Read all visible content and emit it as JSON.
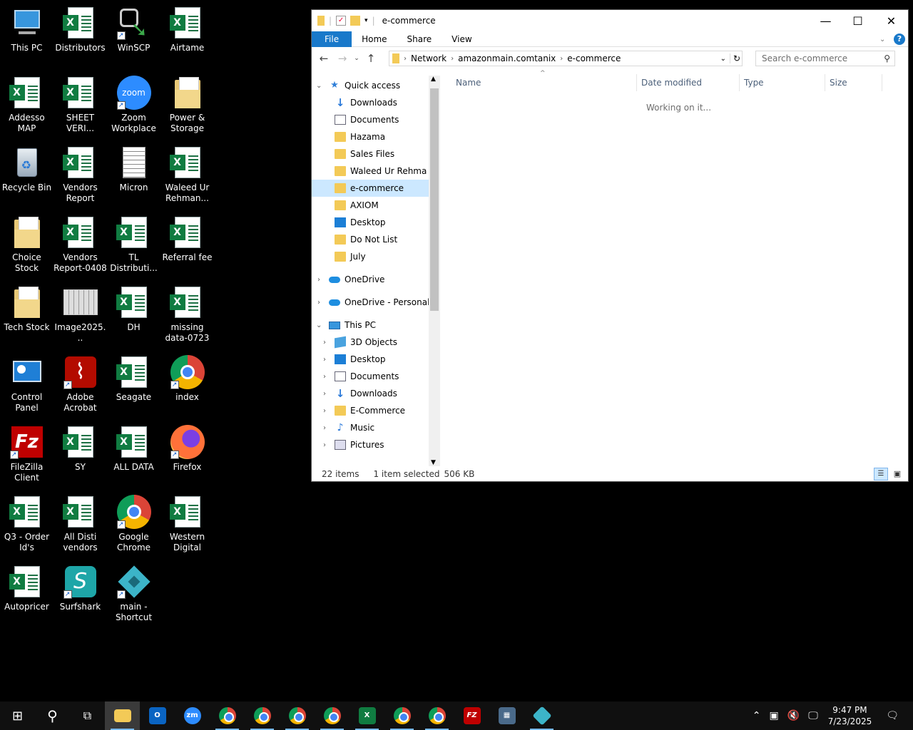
{
  "desktop": {
    "icons": [
      {
        "label": "This PC",
        "icon": "this-pc-icon"
      },
      {
        "label": "Distributors",
        "icon": "excel-icon"
      },
      {
        "label": "WinSCP",
        "icon": "winscp-icon"
      },
      {
        "label": "Airtame",
        "icon": "excel-icon"
      },
      {
        "label": "Addesso MAP",
        "icon": "excel-icon"
      },
      {
        "label": "SHEET VERI...",
        "icon": "excel-icon"
      },
      {
        "label": "Zoom Workplace",
        "icon": "zoom-icon"
      },
      {
        "label": "Power & Storage",
        "icon": "folder-icon"
      },
      {
        "label": "Recycle Bin",
        "icon": "recycle-bin-icon"
      },
      {
        "label": "Vendors Report",
        "icon": "excel-icon"
      },
      {
        "label": "Micron",
        "icon": "text-document-icon"
      },
      {
        "label": "Waleed Ur Rehman...",
        "icon": "excel-icon"
      },
      {
        "label": "Choice Stock",
        "icon": "folder-icon"
      },
      {
        "label": "Vendors Report-0408",
        "icon": "excel-icon"
      },
      {
        "label": "TL Distributi...",
        "icon": "excel-icon"
      },
      {
        "label": "Referral fee",
        "icon": "excel-icon"
      },
      {
        "label": "Tech Stock",
        "icon": "folder-icon"
      },
      {
        "label": "Image2025...",
        "icon": "image-icon"
      },
      {
        "label": "DH",
        "icon": "excel-icon"
      },
      {
        "label": "missing data-0723",
        "icon": "excel-icon"
      },
      {
        "label": "Control Panel",
        "icon": "control-panel-icon"
      },
      {
        "label": "Adobe Acrobat",
        "icon": "acrobat-icon"
      },
      {
        "label": "Seagate",
        "icon": "excel-icon"
      },
      {
        "label": "index",
        "icon": "chrome-icon"
      },
      {
        "label": "FileZilla Client",
        "icon": "filezilla-icon"
      },
      {
        "label": "SY",
        "icon": "excel-icon"
      },
      {
        "label": "ALL DATA",
        "icon": "excel-icon"
      },
      {
        "label": "Firefox",
        "icon": "firefox-icon"
      },
      {
        "label": "Q3 - Order Id's",
        "icon": "excel-icon"
      },
      {
        "label": "All Disti vendors",
        "icon": "excel-icon"
      },
      {
        "label": "Google Chrome",
        "icon": "chrome-icon"
      },
      {
        "label": "Western Digital",
        "icon": "excel-icon"
      },
      {
        "label": "Autopricer",
        "icon": "excel-icon"
      },
      {
        "label": "Surfshark",
        "icon": "surfshark-icon"
      },
      {
        "label": "main - Shortcut",
        "icon": "nutanix-icon"
      }
    ]
  },
  "explorer": {
    "title": "e-commerce",
    "ribbon_tabs": [
      "File",
      "Home",
      "Share",
      "View"
    ],
    "breadcrumb": [
      "Network",
      "amazonmain.comtanix",
      "e-commerce"
    ],
    "search_placeholder": "Search e-commerce",
    "nav": {
      "quick_access": "Quick access",
      "pinned": [
        "Downloads",
        "Documents",
        "Hazama",
        "Sales Files",
        "Waleed Ur Rehma",
        "e-commerce"
      ],
      "recent": [
        "AXIOM",
        "Desktop",
        "Do Not List",
        "July"
      ],
      "onedrive": "OneDrive",
      "onedrive_personal": "OneDrive - Personal",
      "this_pc": "This PC",
      "pc_items": [
        "3D Objects",
        "Desktop",
        "Documents",
        "Downloads",
        "E-Commerce",
        "Music",
        "Pictures"
      ]
    },
    "columns": [
      "Name",
      "Date modified",
      "Type",
      "Size"
    ],
    "status_message": "Working on it...",
    "status": {
      "items": "22 items",
      "selected": "1 item selected",
      "size": "506 KB"
    }
  },
  "taskbar": {
    "time": "9:47 PM",
    "date": "7/23/2025",
    "apps": [
      "file-explorer",
      "outlook",
      "zoom",
      "chrome",
      "chrome",
      "chrome",
      "chrome",
      "excel",
      "chrome",
      "chrome",
      "filezilla",
      "calculator",
      "nutanix"
    ]
  }
}
